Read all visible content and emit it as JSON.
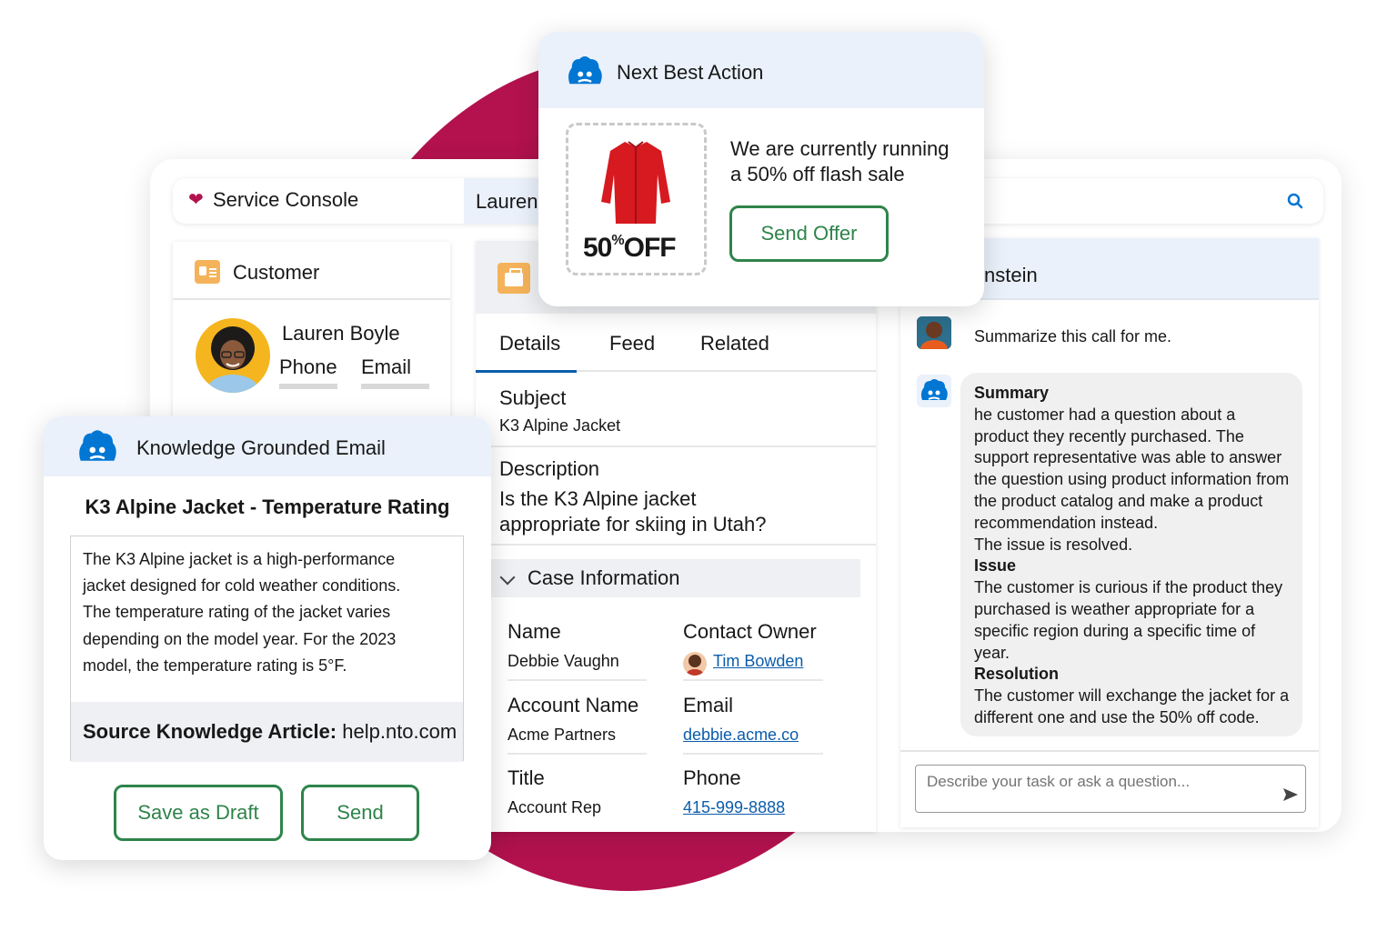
{
  "console": {
    "title": "Service Console",
    "tab_label": "Lauren"
  },
  "customer": {
    "title": "Customer",
    "name": "Lauren Boyle",
    "phone_label": "Phone",
    "email_label": "Email"
  },
  "case": {
    "tabs": [
      "Details",
      "Feed",
      "Related"
    ],
    "subject_label": "Subject",
    "subject_value": "K3 Alpine Jacket",
    "description_label": "Description",
    "description_line1": "Is the K3 Alpine jacket",
    "description_line2": "appropriate for skiing in Utah?",
    "section_label": "Case Information",
    "fields": {
      "name_label": "Name",
      "name_value": "Debbie Vaughn",
      "owner_label": "Contact Owner",
      "owner_value": "Tim Bowden",
      "account_label": "Account Name",
      "account_value": "Acme Partners",
      "email_label": "Email",
      "email_value": "debbie.acme.co",
      "title_label": "Title",
      "title_value": "Account Rep",
      "phone_label": "Phone",
      "phone_value": "415-999-8888"
    }
  },
  "einstein": {
    "title": "nstein",
    "user_message": "Summarize this call for me.",
    "summary_label": "Summary",
    "summary_text": "he customer had a question about a product they recently purchased. The support representative was able to answer the question using product information from the product catalog and make a product recommendation instead.",
    "resolved_text": "The issue is resolved.",
    "issue_label": "Issue",
    "issue_text": "The customer is curious if the product they purchased is weather appropriate for a specific region during a specific time of year.",
    "resolution_label": "Resolution",
    "resolution_text": "The customer will exchange the jacket for a different one and use the 50% off code.",
    "input_placeholder": "Describe your task or ask a question..."
  },
  "next_best_action": {
    "title": "Next Best Action",
    "coupon_amount": "50",
    "coupon_percent": "%",
    "coupon_off": "OFF",
    "message_line1": "We are currently running",
    "message_line2": "a 50% off flash sale",
    "button_label": "Send Offer"
  },
  "knowledge_email": {
    "title": "Knowledge Grounded Email",
    "subject": "K3 Alpine Jacket - Temperature Rating",
    "body_lines": [
      "The K3 Alpine jacket is a high-performance",
      "jacket designed for cold weather conditions.",
      "The temperature rating of the jacket varies",
      "depending on the model year. For the 2023",
      "model, the temperature rating is 5°F."
    ],
    "source_label": "Source Knowledge Article:",
    "source_value": "help.nto.com",
    "save_label": "Save as Draft",
    "send_label": "Send"
  },
  "colors": {
    "accent": "#b3124e",
    "green": "#2e844a",
    "link": "#0b5cab",
    "header_blue": "#eaf1fb",
    "einstein_blue": "#0176d3"
  },
  "icons": [
    "heart-icon",
    "search-icon",
    "contact-card-icon",
    "case-briefcase-icon",
    "einstein-icon",
    "chevron-down-icon",
    "send-arrow-icon",
    "red-jacket-image"
  ]
}
